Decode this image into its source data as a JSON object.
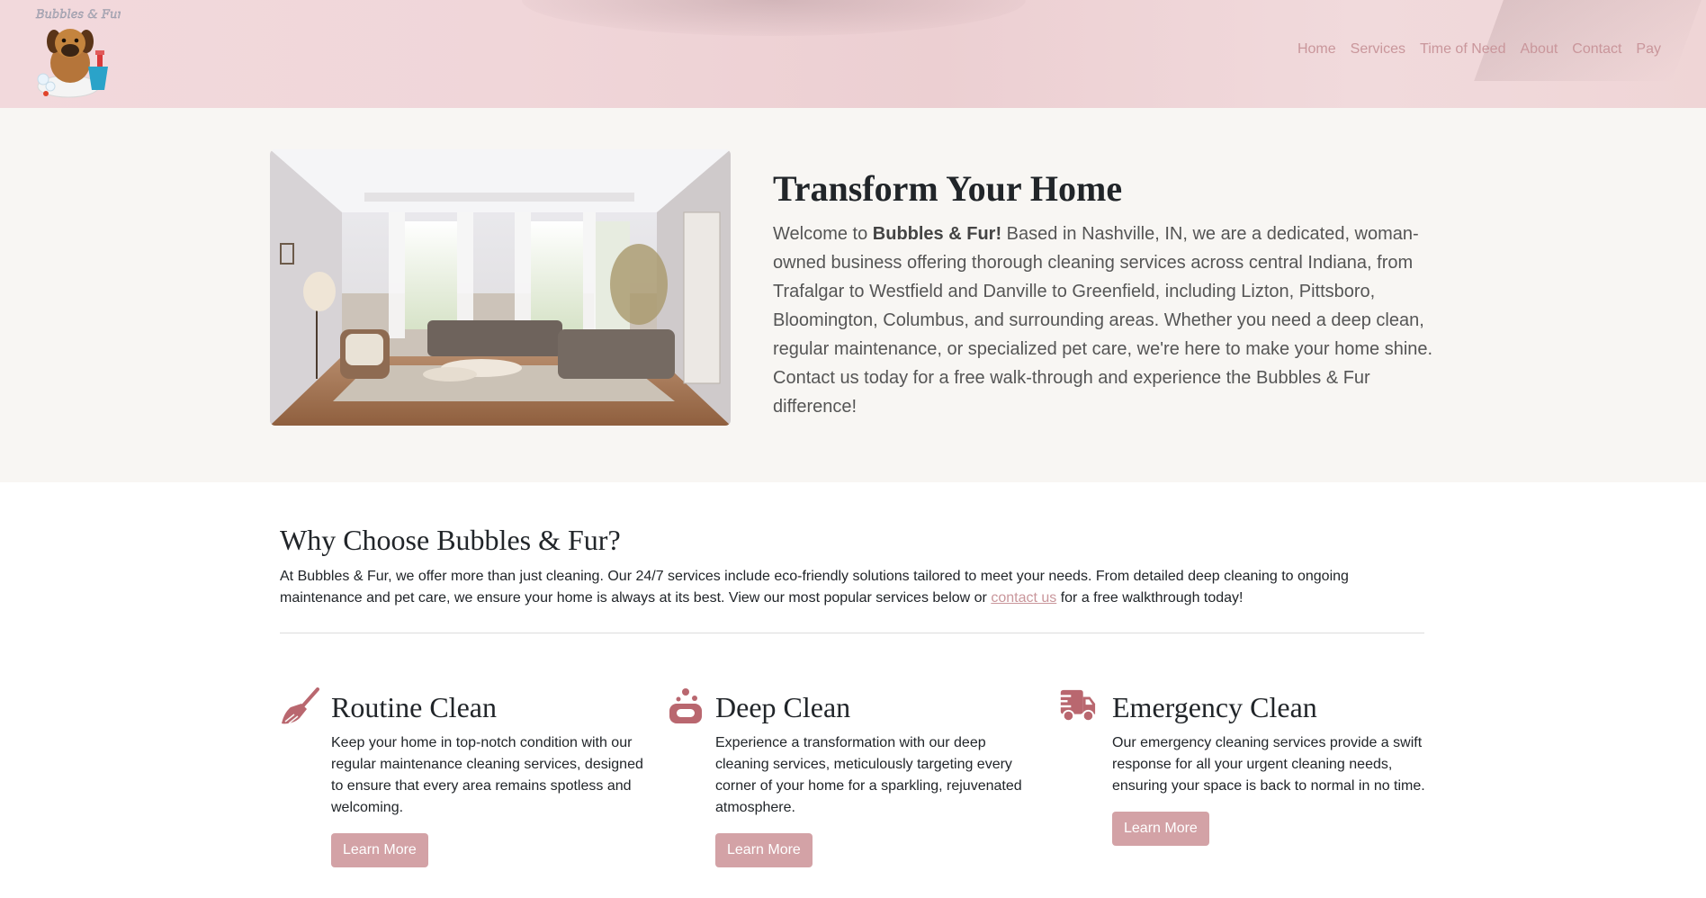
{
  "header": {
    "logo_text": "Bubbles & Fur",
    "nav": [
      {
        "label": "Home"
      },
      {
        "label": "Services"
      },
      {
        "label": "Time of Need"
      },
      {
        "label": "About"
      },
      {
        "label": "Contact"
      },
      {
        "label": "Pay"
      }
    ]
  },
  "hero": {
    "title": "Transform Your Home",
    "body_prefix": "Welcome to ",
    "body_brand": "Bubbles & Fur!",
    "body_rest": " Based in Nashville, IN, we are a dedicated, woman-owned business offering thorough cleaning services across central Indiana, from Trafalgar to Westfield and Danville to Greenfield, including Lizton, Pittsboro, Bloomington, Columbus, and surrounding areas. Whether you need a deep clean, regular maintenance, or specialized pet care, we're here to make your home shine. Contact us today for a free walk-through and experience the Bubbles & Fur difference!"
  },
  "why": {
    "title": "Why Choose Bubbles & Fur?",
    "body_before": "At Bubbles & Fur, we offer more than just cleaning. Our 24/7 services include eco-friendly solutions tailored to meet your needs. From detailed deep cleaning to ongoing maintenance and pet care, we ensure your home is always at its best. View our most popular services below or ",
    "link": "contact us",
    "body_after": " for a free walkthrough today!"
  },
  "features": [
    {
      "icon": "broom-icon",
      "title": "Routine Clean",
      "text": "Keep your home in top-notch condition with our regular maintenance cleaning services, designed to ensure that every area remains spotless and welcoming.",
      "button": "Learn More"
    },
    {
      "icon": "soap-icon",
      "title": "Deep Clean",
      "text": "Experience a transformation with our deep cleaning services, meticulously targeting every corner of your home for a sparkling, rejuvenated atmosphere.",
      "button": "Learn More"
    },
    {
      "icon": "truck-fast-icon",
      "title": "Emergency Clean",
      "text": "Our emergency cleaning services provide a swift response for all your urgent cleaning needs, ensuring your space is back to normal in no time.",
      "button": "Learn More"
    }
  ],
  "colors": {
    "accent": "#c9969b",
    "button": "#d3a2a6",
    "icon": "#b9676f",
    "hero_bg": "#f8f6f3"
  }
}
